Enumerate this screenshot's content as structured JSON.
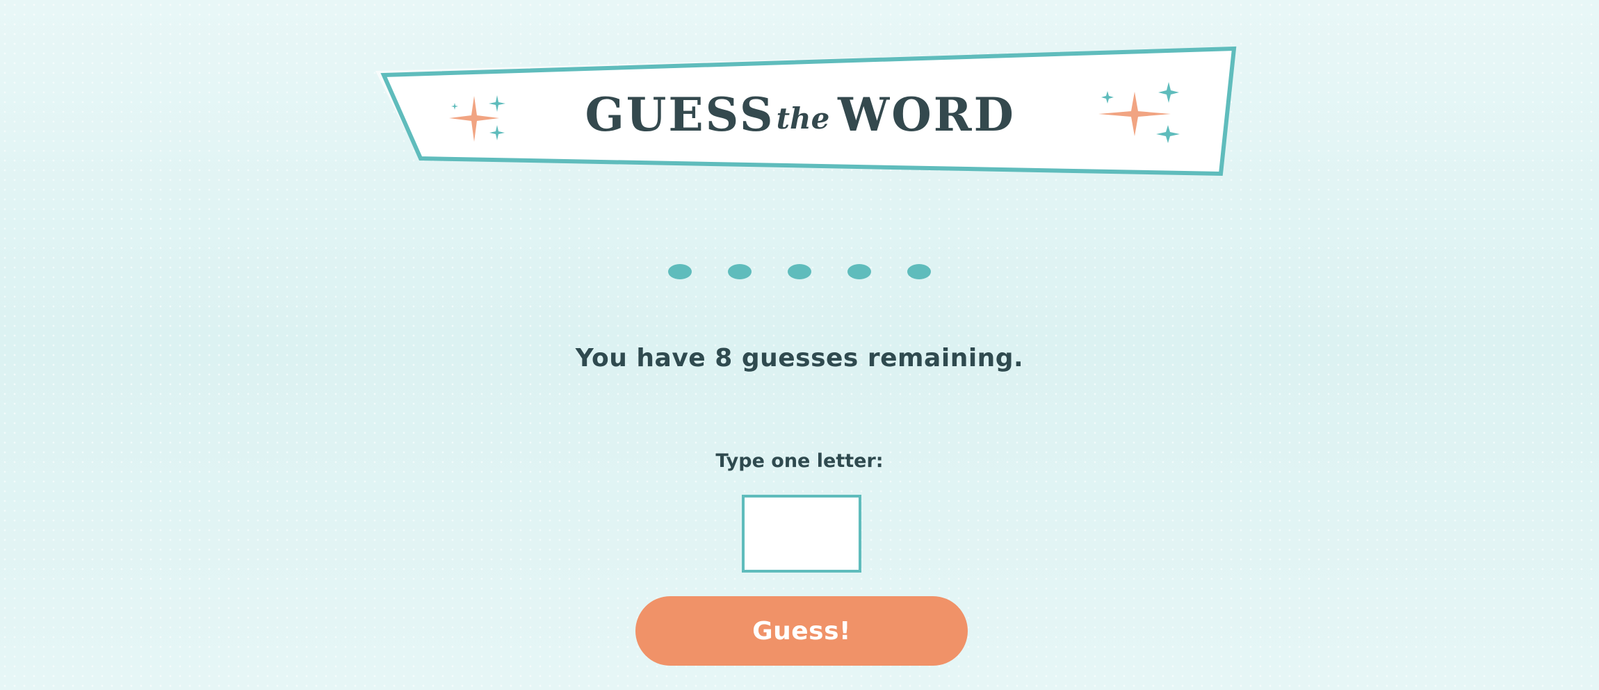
{
  "header": {
    "title_word1": "GUESS",
    "title_word2": "the",
    "title_word3": "WORD"
  },
  "word_progress": {
    "letters": [
      "●",
      "●",
      "●",
      "●",
      "●"
    ]
  },
  "status": {
    "remaining_text": "You have 8 guesses remaining."
  },
  "guess_form": {
    "label": "Type one letter:",
    "input_value": "",
    "button_label": "Guess!"
  },
  "colors": {
    "teal": "#5fbcbc",
    "dark_text": "#2f4a4f",
    "coral": "#f09268",
    "background": "#e1f4f4"
  }
}
